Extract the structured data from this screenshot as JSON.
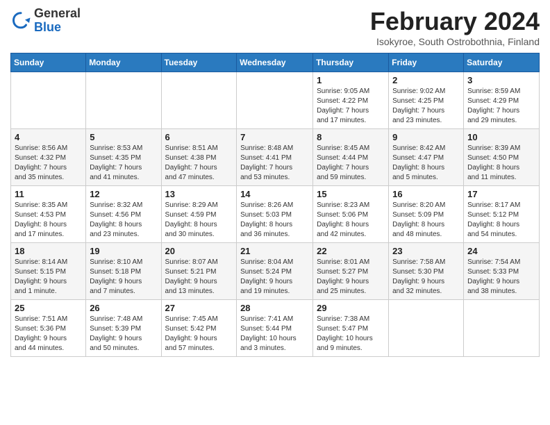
{
  "header": {
    "logo": {
      "general": "General",
      "blue": "Blue"
    },
    "title": "February 2024",
    "location": "Isokyroe, South Ostrobothnia, Finland"
  },
  "calendar": {
    "days_of_week": [
      "Sunday",
      "Monday",
      "Tuesday",
      "Wednesday",
      "Thursday",
      "Friday",
      "Saturday"
    ],
    "weeks": [
      [
        {
          "day": "",
          "info": ""
        },
        {
          "day": "",
          "info": ""
        },
        {
          "day": "",
          "info": ""
        },
        {
          "day": "",
          "info": ""
        },
        {
          "day": "1",
          "info": "Sunrise: 9:05 AM\nSunset: 4:22 PM\nDaylight: 7 hours\nand 17 minutes."
        },
        {
          "day": "2",
          "info": "Sunrise: 9:02 AM\nSunset: 4:25 PM\nDaylight: 7 hours\nand 23 minutes."
        },
        {
          "day": "3",
          "info": "Sunrise: 8:59 AM\nSunset: 4:29 PM\nDaylight: 7 hours\nand 29 minutes."
        }
      ],
      [
        {
          "day": "4",
          "info": "Sunrise: 8:56 AM\nSunset: 4:32 PM\nDaylight: 7 hours\nand 35 minutes."
        },
        {
          "day": "5",
          "info": "Sunrise: 8:53 AM\nSunset: 4:35 PM\nDaylight: 7 hours\nand 41 minutes."
        },
        {
          "day": "6",
          "info": "Sunrise: 8:51 AM\nSunset: 4:38 PM\nDaylight: 7 hours\nand 47 minutes."
        },
        {
          "day": "7",
          "info": "Sunrise: 8:48 AM\nSunset: 4:41 PM\nDaylight: 7 hours\nand 53 minutes."
        },
        {
          "day": "8",
          "info": "Sunrise: 8:45 AM\nSunset: 4:44 PM\nDaylight: 7 hours\nand 59 minutes."
        },
        {
          "day": "9",
          "info": "Sunrise: 8:42 AM\nSunset: 4:47 PM\nDaylight: 8 hours\nand 5 minutes."
        },
        {
          "day": "10",
          "info": "Sunrise: 8:39 AM\nSunset: 4:50 PM\nDaylight: 8 hours\nand 11 minutes."
        }
      ],
      [
        {
          "day": "11",
          "info": "Sunrise: 8:35 AM\nSunset: 4:53 PM\nDaylight: 8 hours\nand 17 minutes."
        },
        {
          "day": "12",
          "info": "Sunrise: 8:32 AM\nSunset: 4:56 PM\nDaylight: 8 hours\nand 23 minutes."
        },
        {
          "day": "13",
          "info": "Sunrise: 8:29 AM\nSunset: 4:59 PM\nDaylight: 8 hours\nand 30 minutes."
        },
        {
          "day": "14",
          "info": "Sunrise: 8:26 AM\nSunset: 5:03 PM\nDaylight: 8 hours\nand 36 minutes."
        },
        {
          "day": "15",
          "info": "Sunrise: 8:23 AM\nSunset: 5:06 PM\nDaylight: 8 hours\nand 42 minutes."
        },
        {
          "day": "16",
          "info": "Sunrise: 8:20 AM\nSunset: 5:09 PM\nDaylight: 8 hours\nand 48 minutes."
        },
        {
          "day": "17",
          "info": "Sunrise: 8:17 AM\nSunset: 5:12 PM\nDaylight: 8 hours\nand 54 minutes."
        }
      ],
      [
        {
          "day": "18",
          "info": "Sunrise: 8:14 AM\nSunset: 5:15 PM\nDaylight: 9 hours\nand 1 minute."
        },
        {
          "day": "19",
          "info": "Sunrise: 8:10 AM\nSunset: 5:18 PM\nDaylight: 9 hours\nand 7 minutes."
        },
        {
          "day": "20",
          "info": "Sunrise: 8:07 AM\nSunset: 5:21 PM\nDaylight: 9 hours\nand 13 minutes."
        },
        {
          "day": "21",
          "info": "Sunrise: 8:04 AM\nSunset: 5:24 PM\nDaylight: 9 hours\nand 19 minutes."
        },
        {
          "day": "22",
          "info": "Sunrise: 8:01 AM\nSunset: 5:27 PM\nDaylight: 9 hours\nand 25 minutes."
        },
        {
          "day": "23",
          "info": "Sunrise: 7:58 AM\nSunset: 5:30 PM\nDaylight: 9 hours\nand 32 minutes."
        },
        {
          "day": "24",
          "info": "Sunrise: 7:54 AM\nSunset: 5:33 PM\nDaylight: 9 hours\nand 38 minutes."
        }
      ],
      [
        {
          "day": "25",
          "info": "Sunrise: 7:51 AM\nSunset: 5:36 PM\nDaylight: 9 hours\nand 44 minutes."
        },
        {
          "day": "26",
          "info": "Sunrise: 7:48 AM\nSunset: 5:39 PM\nDaylight: 9 hours\nand 50 minutes."
        },
        {
          "day": "27",
          "info": "Sunrise: 7:45 AM\nSunset: 5:42 PM\nDaylight: 9 hours\nand 57 minutes."
        },
        {
          "day": "28",
          "info": "Sunrise: 7:41 AM\nSunset: 5:44 PM\nDaylight: 10 hours\nand 3 minutes."
        },
        {
          "day": "29",
          "info": "Sunrise: 7:38 AM\nSunset: 5:47 PM\nDaylight: 10 hours\nand 9 minutes."
        },
        {
          "day": "",
          "info": ""
        },
        {
          "day": "",
          "info": ""
        }
      ]
    ]
  }
}
